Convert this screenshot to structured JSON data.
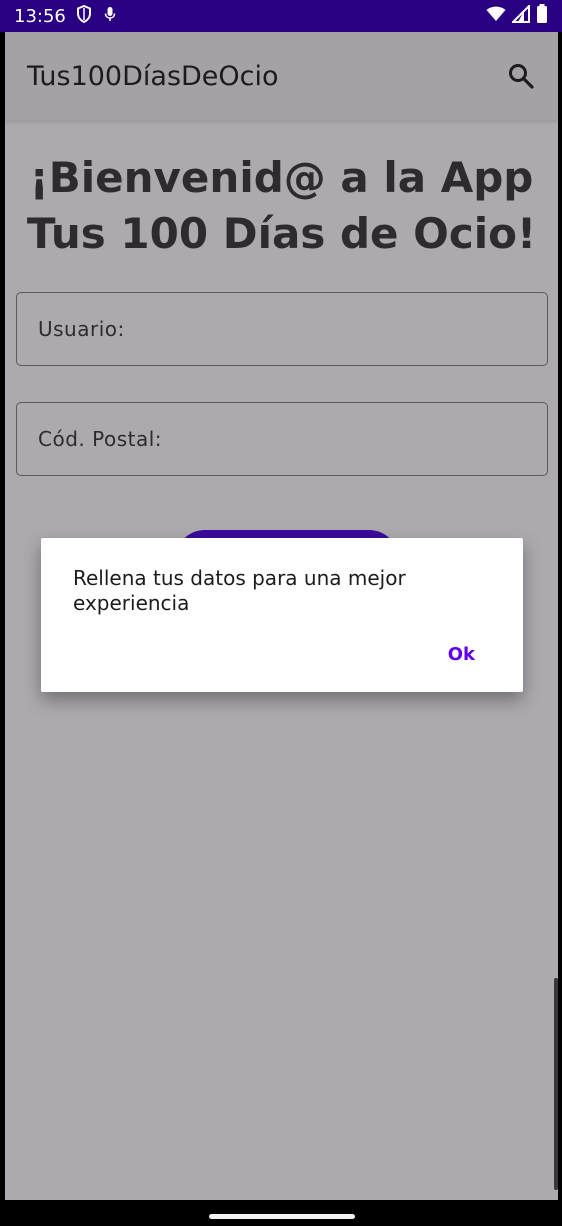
{
  "status_bar": {
    "time": "13:56",
    "icons_left": [
      "shield-icon",
      "mic-icon"
    ],
    "icons_right": [
      "wifi-icon",
      "signal-icon",
      "battery-icon"
    ]
  },
  "toolbar": {
    "title": "Tus100DíasDeOcio",
    "search_icon": "search-icon"
  },
  "main": {
    "welcome_line1": "¡Bienvenid@ a la App",
    "welcome_line2": "Tus 100 Días de Ocio!",
    "usuario_placeholder": "Usuario:",
    "cp_placeholder": "Cód. Postal:"
  },
  "dialog": {
    "message": "Rellena tus datos para una mejor experiencia",
    "ok_label": "Ok"
  },
  "colors": {
    "status_bar": "#2a0082",
    "accent": "#6200ee",
    "scrim_background": "#adaaaf"
  }
}
